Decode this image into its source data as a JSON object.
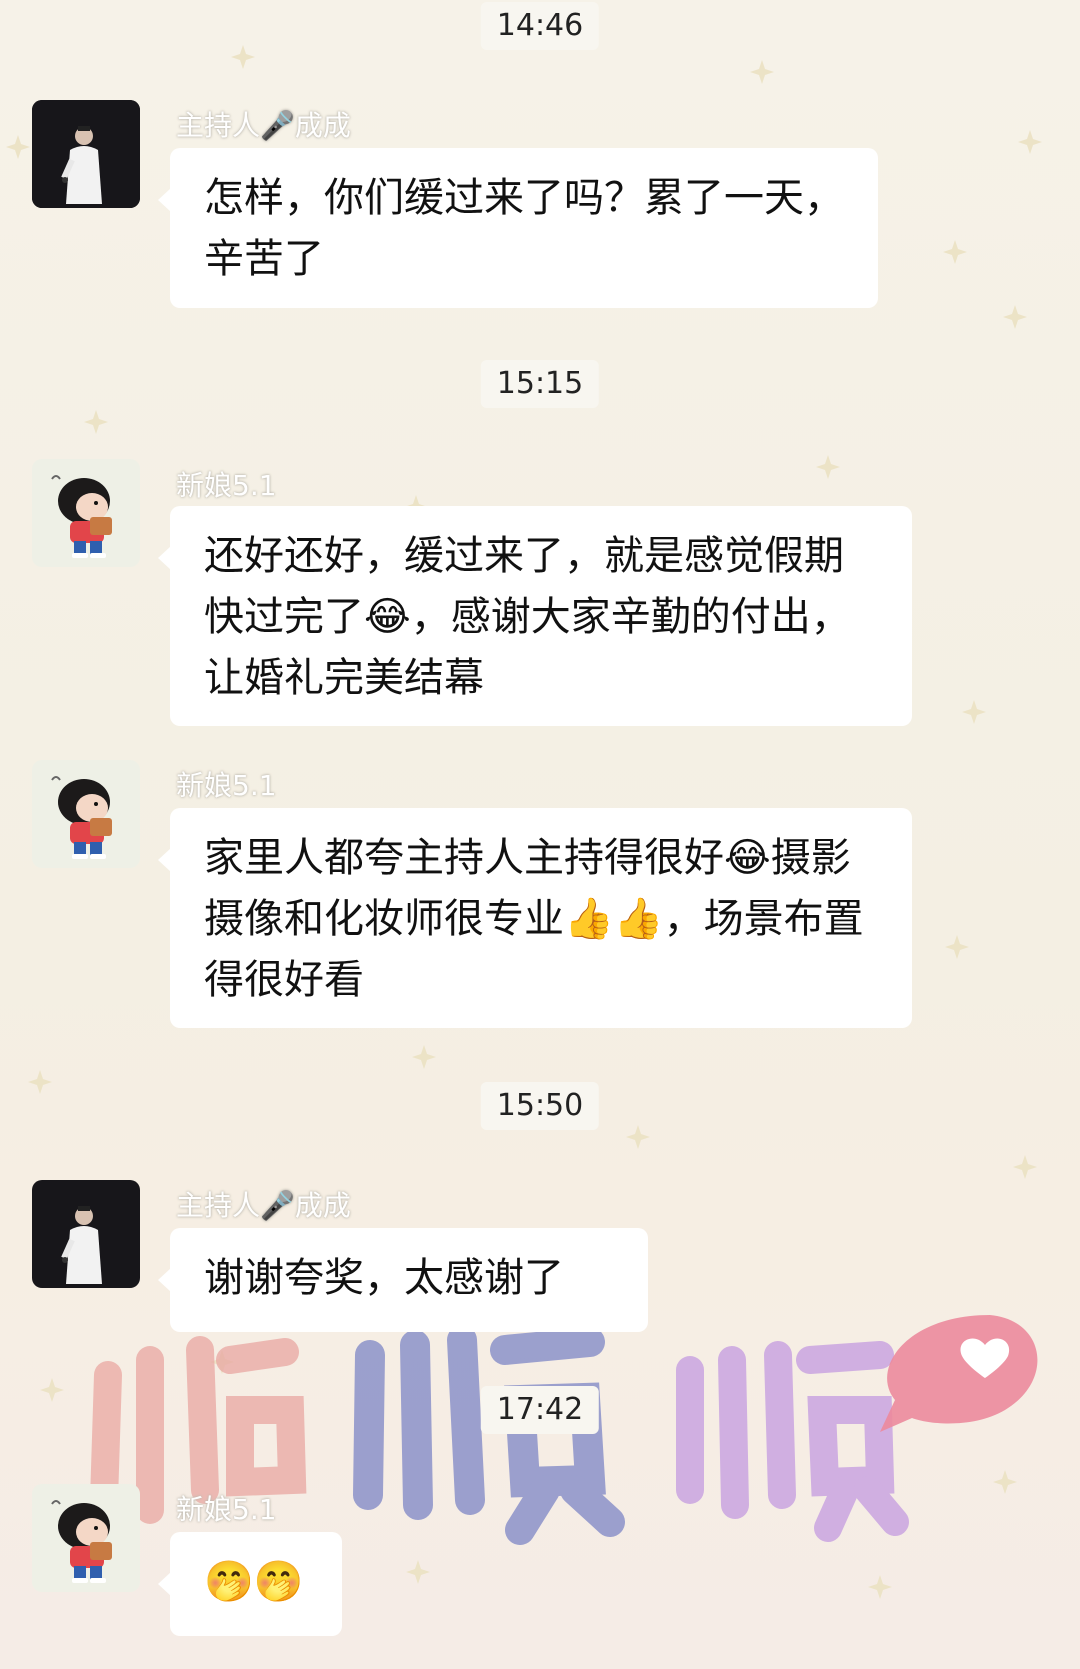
{
  "timestamps": [
    "14:46",
    "15:15",
    "15:50",
    "17:42"
  ],
  "senders": {
    "host": "主持人🎤成成",
    "bride": "新娘5.1"
  },
  "messages": [
    {
      "sender": "主持人🎤成成",
      "text": "怎样，你们缓过来了吗？累了一天，辛苦了"
    },
    {
      "sender": "新娘5.1",
      "text": "还好还好，缓过来了，就是感觉假期快过完了😂，感谢大家辛勤的付出，让婚礼完美结幕"
    },
    {
      "sender": "新娘5.1",
      "text": "家里人都夸主持人主持得很好😂摄影摄像和化妆师很专业👍👍，场景布置得很好看"
    },
    {
      "sender": "主持人🎤成成",
      "text": "谢谢夸奖，太感谢了"
    },
    {
      "sender": "新娘5.1",
      "text": "🤭🤭"
    }
  ],
  "icons": {
    "host_avatar": "host-avatar-icon",
    "bride_avatar": "bride-avatar-icon"
  },
  "watermark": "顺顺顺"
}
